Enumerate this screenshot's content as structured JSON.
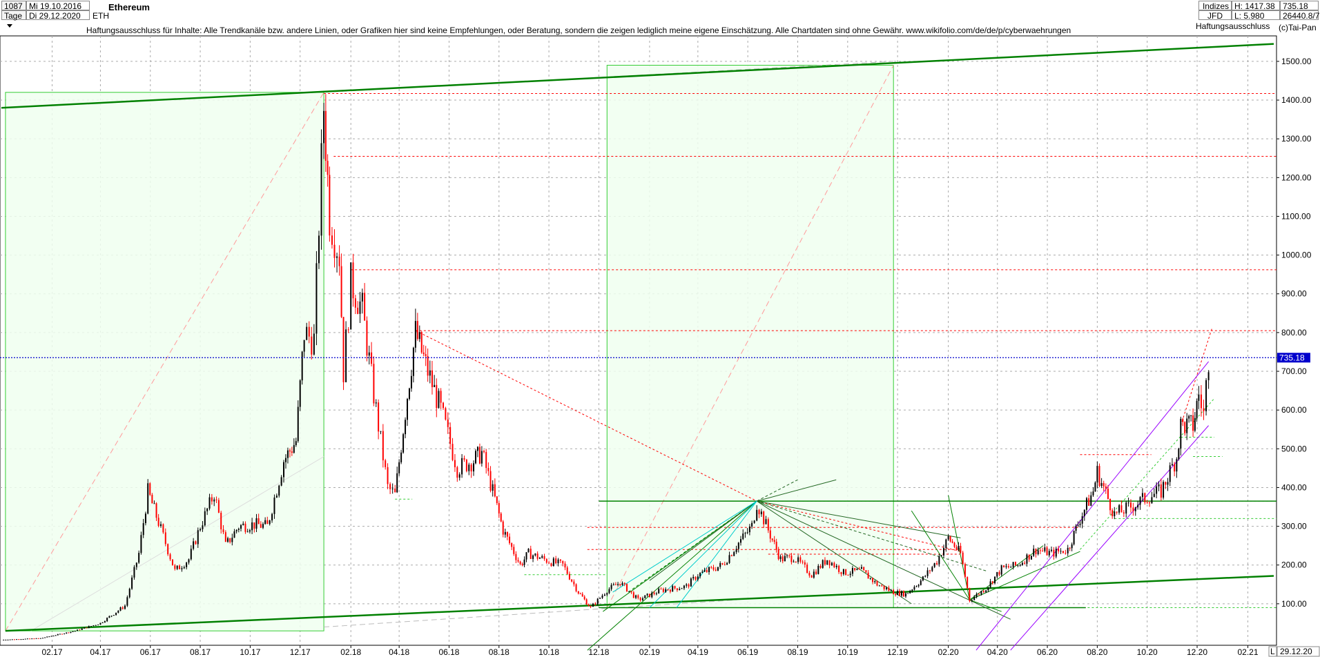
{
  "header": {
    "bar_count": "1087",
    "start_date": "Mi 19.10.2016",
    "period": "Tage",
    "end_date": "Di 29.12.2020",
    "symbol": "ETH",
    "title": "Ethereum",
    "disclaimer": "Haftungsausschluss für Inhalte: Alle Trendkanäle bzw. andere Linien, oder Grafiken hier sind keine Empfehlungen, oder Beratung, sondern die zeigen lediglich meine eigene Einschätzung. Alle Chartdaten sind ohne Gewähr.  www.wikifolio.com/de/de/p/cyberwaehrungen"
  },
  "right_info": {
    "indizes": "Indizes",
    "jfd": "JFD",
    "high": "H: 1417.38",
    "low": "L: 5.980",
    "value1": "735.18",
    "value2": "26440.8/7",
    "haftung": "Haftungsausschluss",
    "copyright": "(c)Tai-Pan"
  },
  "footer": {
    "l_marker": "L",
    "end_date": "29.12.20"
  },
  "colors": {
    "candle_up": "#000000",
    "candle_down": "#ff0000",
    "last_price_line": "#0000cc",
    "last_price_badge": "#0000cc",
    "trend_main": "#008000",
    "box_fill": "#f0fff0",
    "box_stroke": "#33cc33",
    "resistance": "#ff0000",
    "support": "#33cc33",
    "channel": "#9900ff",
    "fan_cyan": "#00cccc"
  },
  "chart_data": {
    "type": "candlestick",
    "title": "Ethereum",
    "ylim": [
      0,
      1550
    ],
    "y_ticks": [
      "100.00",
      "200.00",
      "300.00",
      "400.00",
      "500.00",
      "600.00",
      "700.00",
      "800.00",
      "900.00",
      "1000.00",
      "1100.00",
      "1200.00",
      "1300.00",
      "1400.00",
      "1500.00"
    ],
    "x_ticks": [
      "02.17",
      "04.17",
      "06.17",
      "08.17",
      "10.17",
      "12.17",
      "02.18",
      "04.18",
      "06.18",
      "08.18",
      "10.18",
      "12.18",
      "02.19",
      "04.19",
      "06.19",
      "08.19",
      "10.19",
      "12.19",
      "02.20",
      "04.20",
      "06.20",
      "08.20",
      "10.20",
      "12.20",
      "02.21"
    ],
    "last_price": "735.18",
    "resistance_levels": [
      1417,
      1255,
      962,
      805
    ],
    "support_levels": [
      365,
      297,
      240,
      175,
      90
    ],
    "close_series": [
      {
        "date": "2016-12-15",
        "close": 7
      },
      {
        "date": "2017-02-01",
        "close": 11
      },
      {
        "date": "2017-03-15",
        "close": 30
      },
      {
        "date": "2017-04-15",
        "close": 50
      },
      {
        "date": "2017-05-15",
        "close": 95
      },
      {
        "date": "2017-06-01",
        "close": 230
      },
      {
        "date": "2017-06-12",
        "close": 390
      },
      {
        "date": "2017-06-25",
        "close": 310
      },
      {
        "date": "2017-07-15",
        "close": 185
      },
      {
        "date": "2017-08-01",
        "close": 215
      },
      {
        "date": "2017-08-15",
        "close": 300
      },
      {
        "date": "2017-09-01",
        "close": 385
      },
      {
        "date": "2017-09-15",
        "close": 250
      },
      {
        "date": "2017-10-01",
        "close": 300
      },
      {
        "date": "2017-10-20",
        "close": 305
      },
      {
        "date": "2017-11-05",
        "close": 300
      },
      {
        "date": "2017-11-25",
        "close": 470
      },
      {
        "date": "2017-12-10",
        "close": 520
      },
      {
        "date": "2017-12-20",
        "close": 800
      },
      {
        "date": "2018-01-01",
        "close": 780
      },
      {
        "date": "2018-01-13",
        "close": 1385
      },
      {
        "date": "2018-01-20",
        "close": 1100
      },
      {
        "date": "2018-02-01",
        "close": 1000
      },
      {
        "date": "2018-02-06",
        "close": 700
      },
      {
        "date": "2018-02-15",
        "close": 930
      },
      {
        "date": "2018-03-01",
        "close": 860
      },
      {
        "date": "2018-03-15",
        "close": 640
      },
      {
        "date": "2018-04-01",
        "close": 400
      },
      {
        "date": "2018-04-10",
        "close": 380
      },
      {
        "date": "2018-04-25",
        "close": 640
      },
      {
        "date": "2018-05-05",
        "close": 800
      },
      {
        "date": "2018-05-20",
        "close": 700
      },
      {
        "date": "2018-06-05",
        "close": 600
      },
      {
        "date": "2018-06-25",
        "close": 450
      },
      {
        "date": "2018-07-15",
        "close": 470
      },
      {
        "date": "2018-07-25",
        "close": 490
      },
      {
        "date": "2018-08-10",
        "close": 370
      },
      {
        "date": "2018-08-20",
        "close": 290
      },
      {
        "date": "2018-09-10",
        "close": 200
      },
      {
        "date": "2018-09-20",
        "close": 230
      },
      {
        "date": "2018-10-15",
        "close": 210
      },
      {
        "date": "2018-11-01",
        "close": 200
      },
      {
        "date": "2018-11-20",
        "close": 130
      },
      {
        "date": "2018-12-05",
        "close": 90
      },
      {
        "date": "2018-12-25",
        "close": 135
      },
      {
        "date": "2019-01-10",
        "close": 155
      },
      {
        "date": "2019-02-01",
        "close": 110
      },
      {
        "date": "2019-03-01",
        "close": 135
      },
      {
        "date": "2019-04-01",
        "close": 145
      },
      {
        "date": "2019-04-15",
        "close": 175
      },
      {
        "date": "2019-05-15",
        "close": 200
      },
      {
        "date": "2019-06-01",
        "close": 250
      },
      {
        "date": "2019-06-20",
        "close": 300
      },
      {
        "date": "2019-06-26",
        "close": 360
      },
      {
        "date": "2019-07-10",
        "close": 290
      },
      {
        "date": "2019-07-25",
        "close": 215
      },
      {
        "date": "2019-08-10",
        "close": 220
      },
      {
        "date": "2019-09-01",
        "close": 175
      },
      {
        "date": "2019-09-20",
        "close": 215
      },
      {
        "date": "2019-10-10",
        "close": 180
      },
      {
        "date": "2019-11-01",
        "close": 185
      },
      {
        "date": "2019-11-20",
        "close": 150
      },
      {
        "date": "2019-12-10",
        "close": 130
      },
      {
        "date": "2019-12-25",
        "close": 125
      },
      {
        "date": "2020-01-15",
        "close": 165
      },
      {
        "date": "2020-02-01",
        "close": 210
      },
      {
        "date": "2020-02-15",
        "close": 270
      },
      {
        "date": "2020-03-01",
        "close": 230
      },
      {
        "date": "2020-03-12",
        "close": 110
      },
      {
        "date": "2020-04-01",
        "close": 140
      },
      {
        "date": "2020-04-20",
        "close": 190
      },
      {
        "date": "2020-05-10",
        "close": 200
      },
      {
        "date": "2020-06-01",
        "close": 240
      },
      {
        "date": "2020-06-20",
        "close": 230
      },
      {
        "date": "2020-07-10",
        "close": 240
      },
      {
        "date": "2020-07-25",
        "close": 320
      },
      {
        "date": "2020-08-10",
        "close": 390
      },
      {
        "date": "2020-08-15",
        "close": 440
      },
      {
        "date": "2020-09-05",
        "close": 330
      },
      {
        "date": "2020-09-25",
        "close": 350
      },
      {
        "date": "2020-10-15",
        "close": 375
      },
      {
        "date": "2020-11-01",
        "close": 390
      },
      {
        "date": "2020-11-20",
        "close": 480
      },
      {
        "date": "2020-11-25",
        "close": 560
      },
      {
        "date": "2020-12-10",
        "close": 560
      },
      {
        "date": "2020-12-17",
        "close": 640
      },
      {
        "date": "2020-12-23",
        "close": 590
      },
      {
        "date": "2020-12-29",
        "close": 735
      }
    ]
  }
}
